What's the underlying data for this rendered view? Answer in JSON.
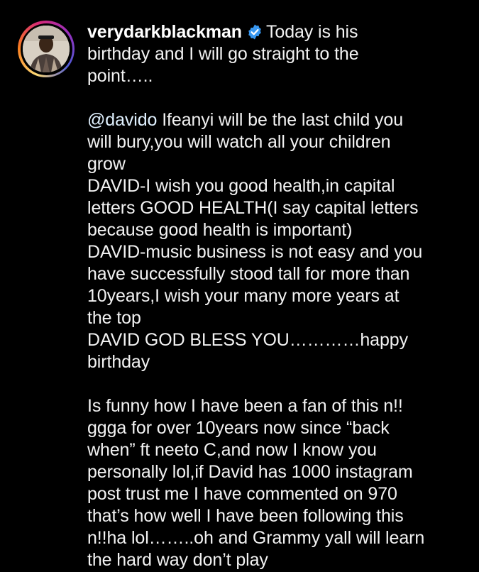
{
  "post": {
    "username": "verydarkblackman",
    "verified_icon": "verified-badge-icon",
    "avatar_icon": "profile-avatar",
    "colors": {
      "background": "#000000",
      "text": "#f2f2f2",
      "verified": "#3897f0",
      "ring": [
        "#feda75",
        "#fa7e1e",
        "#d62976",
        "#962fbf",
        "#4f5bd5"
      ]
    },
    "intro_first": "Today is his",
    "intro_lines": [
      "birthday and I will go straight to the",
      "point….."
    ],
    "mention": "@davido",
    "paragraph2_first": " Ifeanyi will be the last child you",
    "paragraph2_lines": [
      "will bury,you will watch all your children",
      "grow",
      "DAVID-I wish you good health,in capital",
      "letters GOOD HEALTH(I say capital letters",
      "because good health is important)",
      "DAVID-music business is not easy and you",
      "have successfully stood tall for more than",
      "10years,I wish your many more years at",
      "the top",
      "DAVID GOD BLESS YOU…………happy",
      "birthday"
    ],
    "paragraph3_lines": [
      "Is funny how I have been a fan of this n!!",
      "ggga for over 10years now since “back",
      "when” ft neeto C,and now I know you",
      "personally lol,if David has 1000 instagram",
      "post trust me I have commented on 970",
      "that’s how well I have been following this",
      "n!!ha lol……..oh and Grammy yall will learn",
      "the hard way don’t play"
    ]
  }
}
